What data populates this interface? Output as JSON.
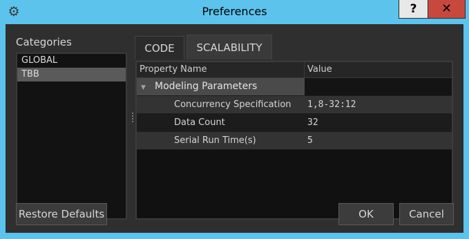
{
  "window": {
    "title": "Preferences",
    "help_label": "?",
    "close_label": "✕"
  },
  "categories": {
    "label": "Categories",
    "items": [
      {
        "label": "GLOBAL"
      },
      {
        "label": "TBB"
      }
    ],
    "selected": "TBB"
  },
  "tabs": [
    {
      "label": "CODE"
    },
    {
      "label": "SCALABILITY"
    }
  ],
  "active_tab": "SCALABILITY",
  "grid": {
    "headers": {
      "name": "Property Name",
      "value": "Value"
    },
    "group": {
      "label": "Modeling Parameters"
    },
    "rows": [
      {
        "name": "Concurrency Specification",
        "value": "1,8-32:12"
      },
      {
        "name": "Data Count",
        "value": "32"
      },
      {
        "name": "Serial Run Time(s)",
        "value": "5"
      }
    ]
  },
  "buttons": {
    "restore": "Restore Defaults",
    "ok": "OK",
    "cancel": "Cancel"
  },
  "colors": {
    "accent": "#5cc3ec",
    "close": "#c7493d",
    "panel": "#2f2f2f"
  }
}
